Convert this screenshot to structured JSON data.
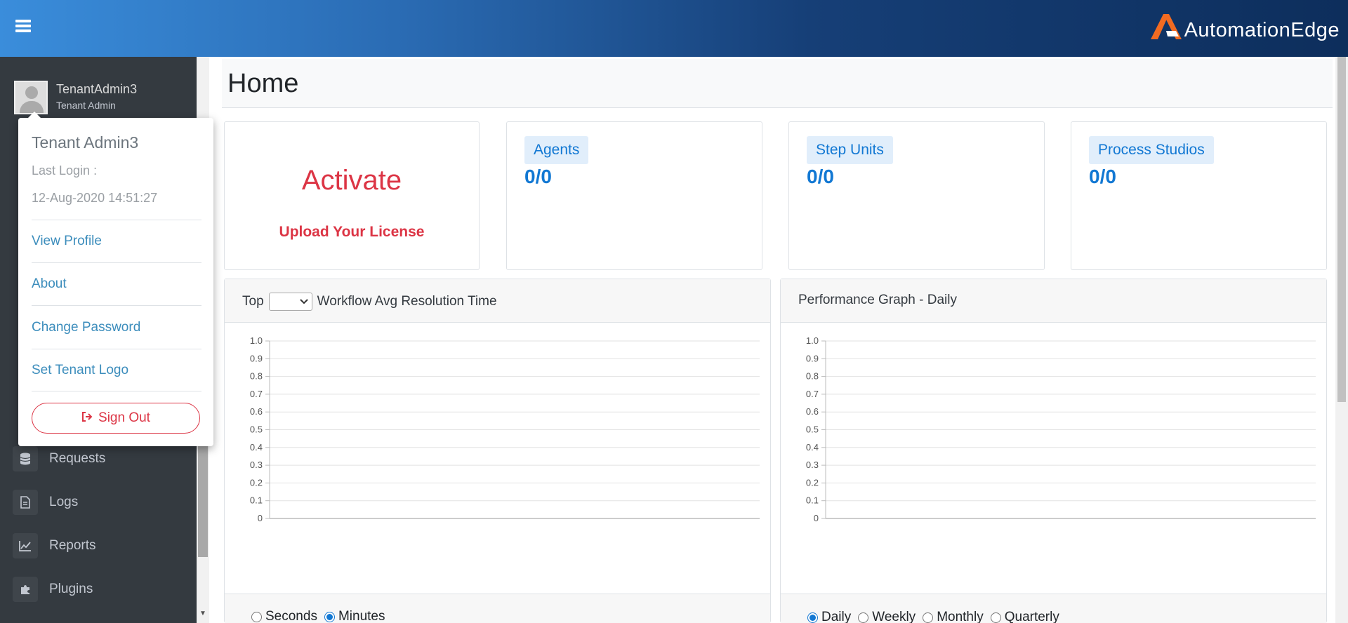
{
  "brand": {
    "name": "AutomationEdge",
    "accent": "#f26b21"
  },
  "user": {
    "name": "TenantAdmin3",
    "role": "Tenant Admin"
  },
  "popup": {
    "display_name": "Tenant Admin3",
    "last_login_label": "Last Login :",
    "last_login_value": "12-Aug-2020 14:51:27",
    "links": [
      "View Profile",
      "About",
      "Change Password",
      "Set Tenant Logo"
    ],
    "sign_out": "Sign Out"
  },
  "sidebar": {
    "items": [
      {
        "label": "Requests",
        "icon": "database-icon"
      },
      {
        "label": "Logs",
        "icon": "file-icon"
      },
      {
        "label": "Reports",
        "icon": "chart-line-icon"
      },
      {
        "label": "Plugins",
        "icon": "puzzle-icon"
      }
    ]
  },
  "page": {
    "title": "Home"
  },
  "license": {
    "title": "Activate",
    "link": "Upload Your License"
  },
  "stats": [
    {
      "label": "Agents",
      "value": "0/0"
    },
    {
      "label": "Step Units",
      "value": "0/0"
    },
    {
      "label": "Process Studios",
      "value": "0/0"
    }
  ],
  "workflow_panel": {
    "title_prefix": "Top",
    "title_suffix": "Workflow Avg Resolution Time",
    "radios": [
      {
        "label": "Seconds",
        "checked": false
      },
      {
        "label": "Minutes",
        "checked": true
      }
    ]
  },
  "performance_panel": {
    "title": "Performance Graph - Daily",
    "radios": [
      {
        "label": "Daily",
        "checked": true
      },
      {
        "label": "Weekly",
        "checked": false
      },
      {
        "label": "Monthly",
        "checked": false
      },
      {
        "label": "Quarterly",
        "checked": false
      }
    ]
  },
  "chart_data": [
    {
      "type": "bar",
      "title": "",
      "xlabel": "",
      "ylabel": "",
      "ylim": [
        0,
        1
      ],
      "yticks": [
        "1.0",
        "0.9",
        "0.8",
        "0.7",
        "0.6",
        "0.5",
        "0.4",
        "0.3",
        "0.2",
        "0.1",
        "0"
      ],
      "categories": [],
      "values": [],
      "grid": true
    },
    {
      "type": "line",
      "title": "",
      "xlabel": "",
      "ylabel": "",
      "ylim": [
        0,
        1
      ],
      "yticks": [
        "1.0",
        "0.9",
        "0.8",
        "0.7",
        "0.6",
        "0.5",
        "0.4",
        "0.3",
        "0.2",
        "0.1",
        "0"
      ],
      "x": [],
      "series": [],
      "grid": true
    }
  ]
}
